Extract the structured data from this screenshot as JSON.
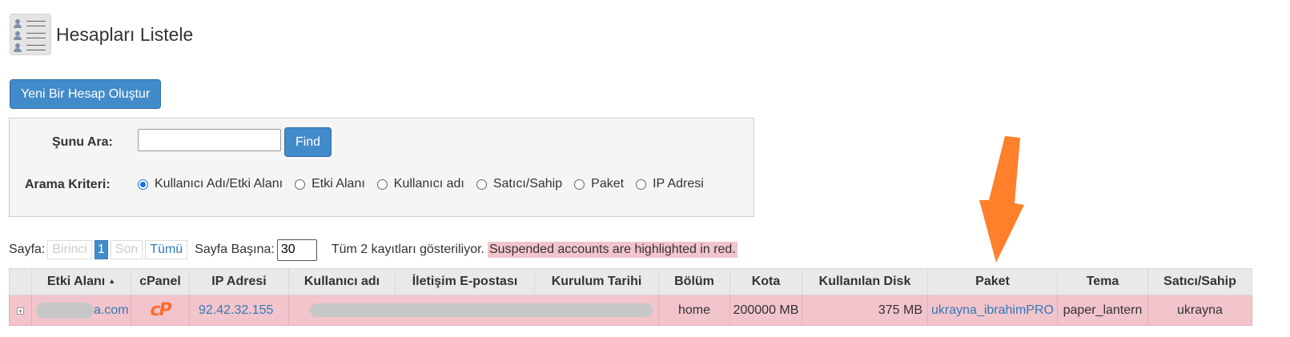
{
  "header": {
    "title": "Hesapları Listele",
    "icon": "account-list-icon"
  },
  "create_button": "Yeni Bir Hesap Oluştur",
  "search": {
    "label": "Şunu Ara:",
    "value": "",
    "placeholder": "",
    "find_label": "Find",
    "criteria_label": "Arama Kriteri:",
    "options": [
      {
        "label": "Kullanıcı Adı/Etki Alanı",
        "checked": true
      },
      {
        "label": "Etki Alanı",
        "checked": false
      },
      {
        "label": "Kullanıcı adı",
        "checked": false
      },
      {
        "label": "Satıcı/Sahip",
        "checked": false
      },
      {
        "label": "Paket",
        "checked": false
      },
      {
        "label": "IP Adresi",
        "checked": false
      }
    ]
  },
  "pager": {
    "label": "Sayfa:",
    "first": "Birinci",
    "current": "1",
    "last": "Son",
    "all": "Tümü",
    "per_page_label": "Sayfa Başına:",
    "per_page_value": "30",
    "records_text": "Tüm 2 kayıtları gösteriliyor.",
    "suspended_note": "Suspended accounts are highlighted in red."
  },
  "table": {
    "columns": [
      "Etki Alanı",
      "cPanel",
      "IP Adresi",
      "Kullanıcı adı",
      "İletişim E-postası",
      "Kurulum Tarihi",
      "Bölüm",
      "Kota",
      "Kullanılan Disk",
      "Paket",
      "Tema",
      "Satıcı/Sahip"
    ],
    "sort_indicator": "▲",
    "rows": [
      {
        "expand": "+",
        "domain_suffix": "a.com",
        "cpanel_logo": "cP",
        "ip": "92.42.32.155",
        "partition": "home",
        "quota": "200000 MB",
        "disk_used": "375 MB",
        "package": "ukrayna_ibrahimPRO",
        "theme": "paper_lantern",
        "owner": "ukrayna"
      }
    ]
  },
  "colors": {
    "primary_button": "#428bca",
    "suspended_row": "#f2c4cc",
    "link": "#337ab7",
    "arrow": "#ff7f2a",
    "cpanel": "#ff6c2c"
  }
}
